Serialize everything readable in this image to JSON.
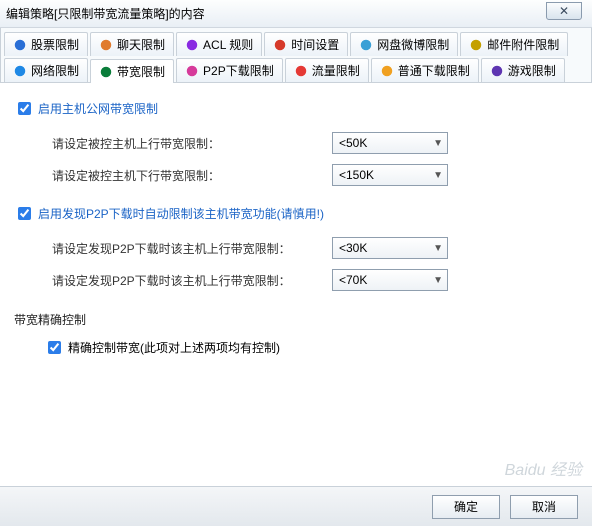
{
  "title": "编辑策略[只限制带宽流量策略]的内容",
  "close_glyph": "✕",
  "tabs_row1": [
    {
      "label": "股票限制",
      "icon": "#2a6fd6"
    },
    {
      "label": "聊天限制",
      "icon": "#e07b2e"
    },
    {
      "label": "ACL 规则",
      "icon": "#8a2be2"
    },
    {
      "label": "时间设置",
      "icon": "#d63a2a"
    },
    {
      "label": "网盘微博限制",
      "icon": "#3aa0d6"
    },
    {
      "label": "邮件附件限制",
      "icon": "#c4a000"
    }
  ],
  "tabs_row2": [
    {
      "label": "网络限制",
      "icon": "#1e88e5"
    },
    {
      "label": "带宽限制",
      "icon": "#0a7d3a",
      "active": true
    },
    {
      "label": "P2P下载限制",
      "icon": "#d63a9a"
    },
    {
      "label": "流量限制",
      "icon": "#e53935"
    },
    {
      "label": "普通下载限制",
      "icon": "#f0a020"
    },
    {
      "label": "游戏限制",
      "icon": "#5e35b1"
    }
  ],
  "wan_enable": "启用主机公网带宽限制",
  "wan_up_label": "请设定被控主机上行带宽限制：",
  "wan_up_value": "<50K",
  "wan_down_label": "请设定被控主机下行带宽限制：",
  "wan_down_value": "<150K",
  "p2p_enable": "启用发现P2P下载时自动限制该主机带宽功能(请慎用!)",
  "p2p_up_label": "请设定发现P2P下载时该主机上行带宽限制：",
  "p2p_up_value": "<30K",
  "p2p_down_label": "请设定发现P2P下载时该主机上行带宽限制：",
  "p2p_down_value": "<70K",
  "precise_title": "带宽精确控制",
  "precise_check": "精确控制带宽(此项对上述两项均有控制)",
  "ok": "确定",
  "cancel": "取消",
  "watermark": "Baidu 经验"
}
